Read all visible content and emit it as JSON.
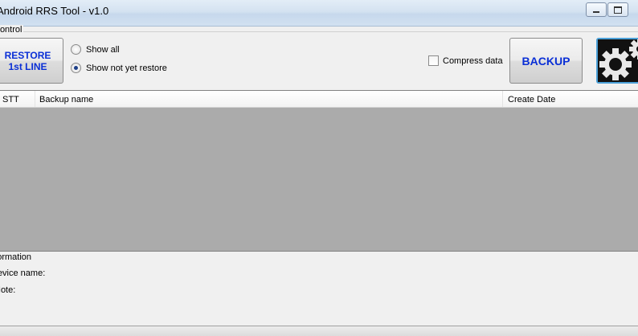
{
  "window": {
    "title": "Android RRS Tool - v1.0",
    "controls": [
      "minimize",
      "maximize"
    ]
  },
  "control_group": {
    "label": "Control",
    "restore_button": {
      "line1": "RESTORE",
      "line2": "1st LINE"
    },
    "radio_options": [
      {
        "label": "Show all",
        "checked": false
      },
      {
        "label": "Show not yet restore",
        "checked": true
      }
    ],
    "compress_checkbox": {
      "label": "Compress data",
      "checked": false
    },
    "backup_button": "BACKUP",
    "settings_button_icon": "gears-icon"
  },
  "backup_list": {
    "columns": [
      "STT",
      "Backup name",
      "Create Date"
    ],
    "rows": []
  },
  "information": {
    "label": "Information",
    "fields": [
      "Device name:",
      "Note:"
    ]
  },
  "colors": {
    "button_text": "#0a2fd6",
    "list_background": "#ababab",
    "settings_border": "#4ba0d8"
  }
}
